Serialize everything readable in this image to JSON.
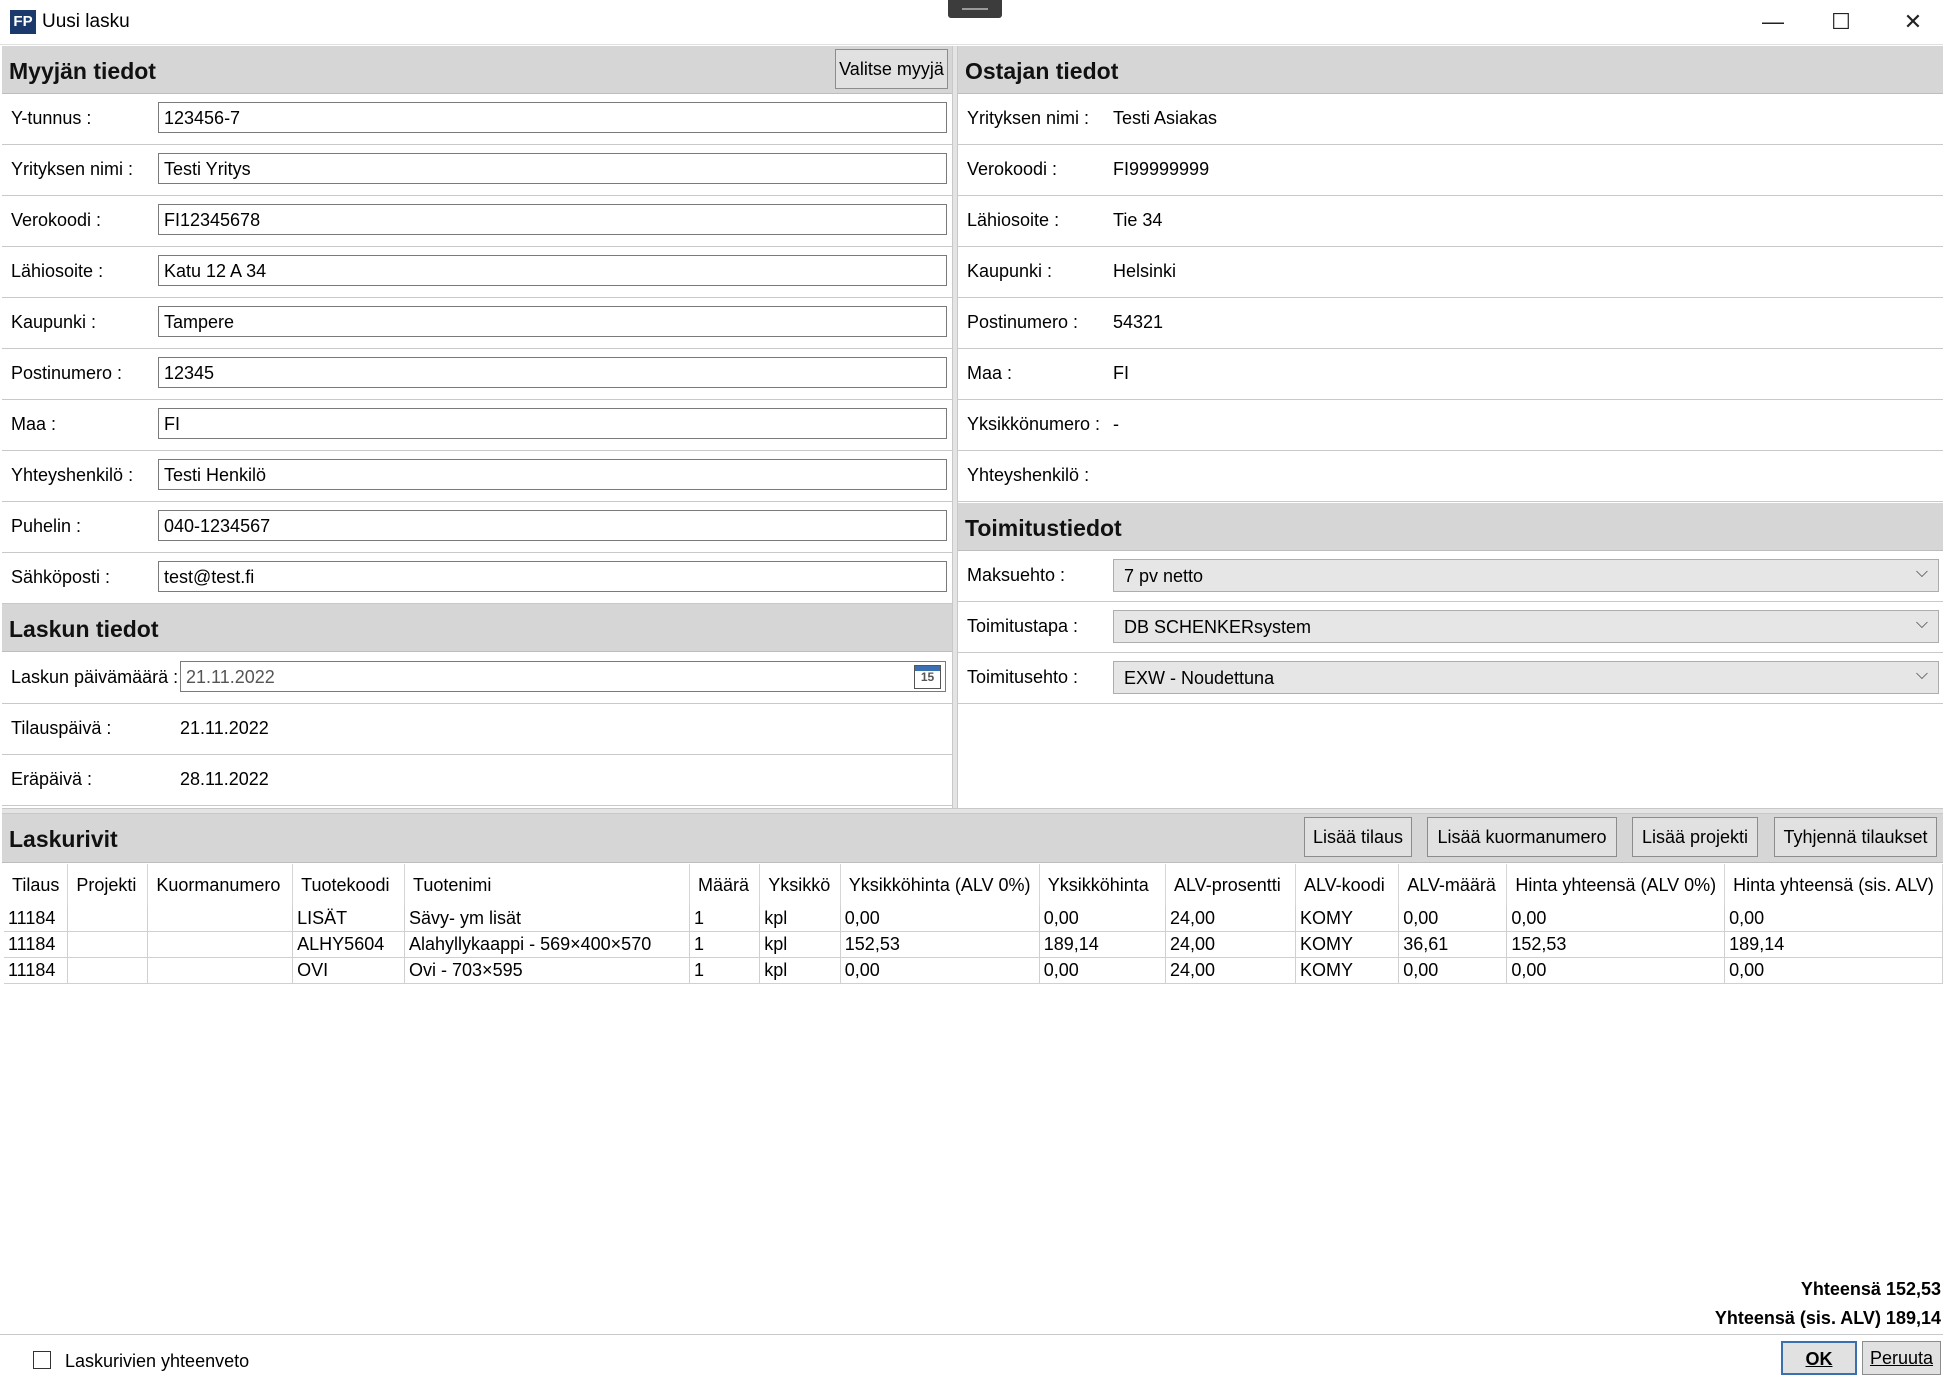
{
  "window": {
    "icon": "FP",
    "title": "Uusi lasku",
    "minimize": "—",
    "maximize": "☐",
    "close": "✕"
  },
  "seller": {
    "title": "Myyjän tiedot",
    "select_button": "Valitse myyjä",
    "fields": [
      {
        "label": "Y-tunnus :",
        "value": "123456-7"
      },
      {
        "label": "Yrityksen nimi :",
        "value": "Testi Yritys"
      },
      {
        "label": "Verokoodi :",
        "value": "FI12345678"
      },
      {
        "label": "Lähiosoite :",
        "value": "Katu 12 A 34"
      },
      {
        "label": "Kaupunki :",
        "value": "Tampere"
      },
      {
        "label": "Postinumero :",
        "value": "12345"
      },
      {
        "label": "Maa :",
        "value": "FI"
      },
      {
        "label": "Yhteyshenkilö :",
        "value": "Testi Henkilö"
      },
      {
        "label": "Puhelin :",
        "value": "040-1234567"
      },
      {
        "label": "Sähköposti :",
        "value": "test@test.fi"
      }
    ]
  },
  "invoice": {
    "title": "Laskun tiedot",
    "date_label": "Laskun päivämäärä :",
    "date_value": "21.11.2022",
    "calendar_day": "15",
    "order_date_label": "Tilauspäivä :",
    "order_date_value": "21.11.2022",
    "due_date_label": "Eräpäivä :",
    "due_date_value": "28.11.2022"
  },
  "buyer": {
    "title": "Ostajan tiedot",
    "fields": [
      {
        "label": "Yrityksen nimi :",
        "value": "Testi Asiakas"
      },
      {
        "label": "Verokoodi :",
        "value": "FI99999999"
      },
      {
        "label": "Lähiosoite :",
        "value": "Tie 34"
      },
      {
        "label": "Kaupunki :",
        "value": "Helsinki"
      },
      {
        "label": "Postinumero :",
        "value": "54321"
      },
      {
        "label": "Maa :",
        "value": "FI"
      },
      {
        "label": "Yksikkönumero :",
        "value": "-"
      },
      {
        "label": "Yhteyshenkilö :",
        "value": ""
      }
    ]
  },
  "delivery": {
    "title": "Toimitustiedot",
    "fields": [
      {
        "label": "Maksuehto :",
        "value": "7 pv netto"
      },
      {
        "label": "Toimitustapa :",
        "value": "DB SCHENKERsystem"
      },
      {
        "label": "Toimitusehto :",
        "value": "EXW - Noudettuna"
      }
    ]
  },
  "rows_section": {
    "title": "Laskurivit",
    "buttons": [
      "Lisää tilaus",
      "Lisää kuormanumero",
      "Lisää projekti",
      "Tyhjennä tilaukset"
    ],
    "columns": [
      "Tilaus",
      "Projekti",
      "Kuormanumero",
      "Tuotekoodi",
      "Tuotenimi",
      "Määrä",
      "Yksikkö",
      "Yksikköhinta (ALV 0%)",
      "Yksikköhinta",
      "ALV-prosentti",
      "ALV-koodi",
      "ALV-määrä",
      "Hinta yhteensä (ALV 0%)",
      "Hinta yhteensä (sis. ALV)"
    ],
    "rows": [
      [
        "11184",
        "",
        "",
        "LISÄT",
        "Sävy- ym lisät",
        "1",
        "kpl",
        "0,00",
        "0,00",
        "24,00",
        "KOMY",
        "0,00",
        "0,00",
        "0,00"
      ],
      [
        "11184",
        "",
        "",
        "ALHY5604",
        "Alahyllykaappi - 569×400×570",
        "1",
        "kpl",
        "152,53",
        "189,14",
        "24,00",
        "KOMY",
        "36,61",
        "152,53",
        "189,14"
      ],
      [
        "11184",
        "",
        "",
        "OVI",
        "Ovi - 703×595",
        "1",
        "kpl",
        "0,00",
        "0,00",
        "24,00",
        "KOMY",
        "0,00",
        "0,00",
        "0,00"
      ]
    ]
  },
  "totals": {
    "net": "Yhteensä 152,53",
    "gross": "Yhteensä (sis. ALV) 189,14"
  },
  "footer": {
    "summary_label": "Laskurivien yhteenveto",
    "summary_checked": false,
    "ok": "OK",
    "cancel": "Peruuta"
  }
}
